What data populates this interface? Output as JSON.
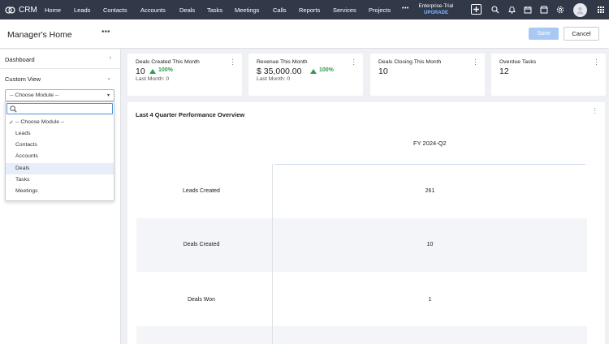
{
  "topnav": {
    "logo_text": "CRM",
    "links": [
      "Home",
      "Leads",
      "Contacts",
      "Accounts",
      "Deals",
      "Tasks",
      "Meetings",
      "Calls",
      "Reports",
      "Services",
      "Projects"
    ],
    "more": "•••",
    "trial_line1": "Enterprise-Trial",
    "trial_line2": "UPGRADE",
    "icons": [
      "add-icon",
      "search-icon",
      "bell-icon",
      "calendar-icon",
      "marketplace-icon",
      "settings-icon",
      "avatar",
      "apps-grid-icon"
    ]
  },
  "header": {
    "title": "Manager's Home",
    "more": "•••",
    "save_label": "Save",
    "cancel_label": "Cancel"
  },
  "leftpanel": {
    "dashboard_label": "Dashboard",
    "custom_view_label": "Custom View",
    "module_select_value": "-- Choose Module --"
  },
  "dropdown": {
    "items": [
      "-- Choose Module --",
      "Leads",
      "Contacts",
      "Accounts",
      "Deals",
      "Tasks",
      "Meetings"
    ],
    "checked_item": "-- Choose Module --",
    "highlighted_item": "Deals"
  },
  "cards": [
    {
      "title": "Deals Created This Month",
      "value": "10",
      "percent": "100%",
      "last": "Last Month: 0"
    },
    {
      "title": "Revenue This Month",
      "value": "$ 35,000.00",
      "percent": "100%",
      "last": "Last Month: 0"
    },
    {
      "title": "Deals Closing This Month",
      "value": "10"
    },
    {
      "title": "Overdue Tasks",
      "value": "12"
    }
  ],
  "performance": {
    "title": "Last 4 Quarter Performance Overview",
    "column": "FY 2024-Q2",
    "rows": [
      {
        "label": "Leads Created",
        "value": "261"
      },
      {
        "label": "Deals Created",
        "value": "10"
      },
      {
        "label": "Deals Won",
        "value": "1"
      }
    ]
  },
  "colors": {
    "nav_bg": "#313949",
    "accent": "#4a90e2",
    "positive": "#2e9b4e",
    "save_disabled": "#a9c9f5"
  }
}
